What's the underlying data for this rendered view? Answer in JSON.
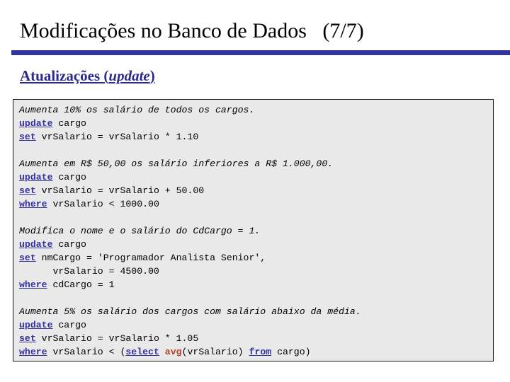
{
  "slide": {
    "title": "Modificações no Banco de Dados   (7/7)",
    "subtitle_main": "Atualizações (",
    "subtitle_italic": "update",
    "subtitle_tail": ")",
    "accent_color": "#33339F",
    "subtitle_color": "#2B2B8C",
    "keyword_color": "#33339F",
    "function_color": "#B24126",
    "panel_bg": "#E9E9E9",
    "panel_border": "#1A1A1A",
    "page_bg": "#FFFFFF"
  },
  "code_blocks": [
    {
      "comment": "Aumenta 10% os salário de todos os cargos.",
      "lines": [
        [
          {
            "t": "update",
            "c": "kw"
          },
          {
            "t": " cargo",
            "c": "plain"
          }
        ],
        [
          {
            "t": "set",
            "c": "kw"
          },
          {
            "t": " vrSalario = vrSalario * 1.10",
            "c": "plain"
          }
        ]
      ]
    },
    {
      "comment": "Aumenta em R$ 50,00 os salário inferiores a R$ 1.000,00.",
      "lines": [
        [
          {
            "t": "update",
            "c": "kw"
          },
          {
            "t": " cargo",
            "c": "plain"
          }
        ],
        [
          {
            "t": "set",
            "c": "kw"
          },
          {
            "t": " vrSalario = vrSalario + 50.00",
            "c": "plain"
          }
        ],
        [
          {
            "t": "where",
            "c": "kw"
          },
          {
            "t": " vrSalario < 1000.00",
            "c": "plain"
          }
        ]
      ]
    },
    {
      "comment": "Modifica o nome e o salário do CdCargo = 1.",
      "lines": [
        [
          {
            "t": "update",
            "c": "kw"
          },
          {
            "t": " cargo",
            "c": "plain"
          }
        ],
        [
          {
            "t": "set",
            "c": "kw"
          },
          {
            "t": " nmCargo = 'Programador Analista Senior',",
            "c": "plain"
          }
        ],
        [
          {
            "t": "      vrSalario = 4500.00",
            "c": "plain"
          }
        ],
        [
          {
            "t": "where",
            "c": "kw"
          },
          {
            "t": " cdCargo = 1",
            "c": "plain"
          }
        ]
      ]
    },
    {
      "comment": "Aumenta 5% os salário dos cargos com salário abaixo da média.",
      "lines": [
        [
          {
            "t": "update",
            "c": "kw"
          },
          {
            "t": " cargo",
            "c": "plain"
          }
        ],
        [
          {
            "t": "set",
            "c": "kw"
          },
          {
            "t": " vrSalario = vrSalario * 1.05",
            "c": "plain"
          }
        ],
        [
          {
            "t": "where",
            "c": "kw"
          },
          {
            "t": " vrSalario < (",
            "c": "plain"
          },
          {
            "t": "select",
            "c": "kw"
          },
          {
            "t": " ",
            "c": "plain"
          },
          {
            "t": "avg",
            "c": "fn"
          },
          {
            "t": "(vrSalario) ",
            "c": "plain"
          },
          {
            "t": "from",
            "c": "kw"
          },
          {
            "t": " cargo)",
            "c": "plain"
          }
        ]
      ]
    }
  ]
}
